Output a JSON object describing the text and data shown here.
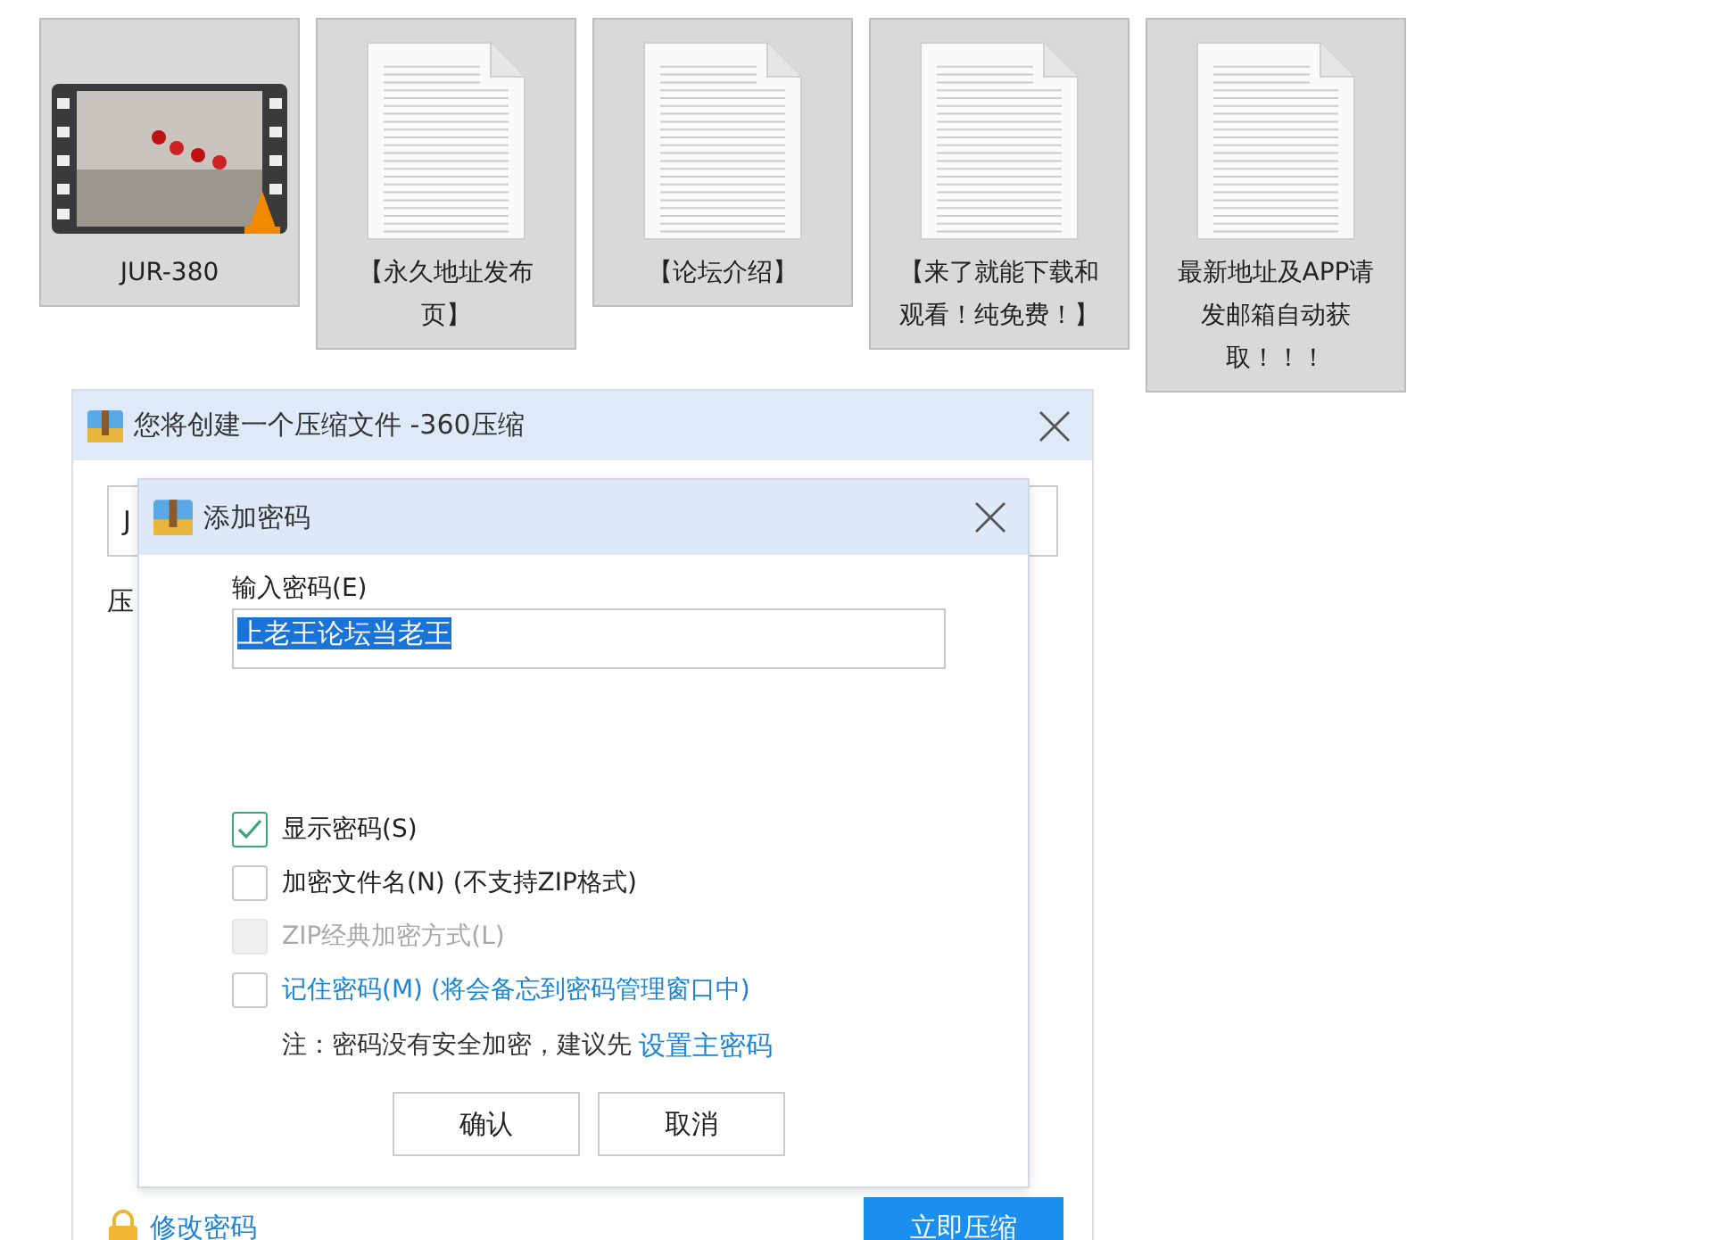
{
  "files": [
    {
      "kind": "video",
      "name": "JUR-380",
      "selected": true
    },
    {
      "kind": "document",
      "name": "【永久地址发布页】",
      "selected": true
    },
    {
      "kind": "document",
      "name": "【论坛介绍】",
      "selected": true
    },
    {
      "kind": "document",
      "name": "【来了就能下载和观看！纯免费！】",
      "selected": true
    },
    {
      "kind": "document",
      "name": "最新地址及APP请发邮箱自动获取！！！",
      "selected": true
    }
  ],
  "compress_dialog": {
    "title": "您将创建一个压缩文件 -360压缩",
    "archive_field": "J",
    "label": "压",
    "change_password_link": "修改密码",
    "compress_button": "立即压缩"
  },
  "password_dialog": {
    "title": "添加密码",
    "password_label": "输入密码(E)",
    "password_value": "上老王论坛当老王",
    "value_highlighted": true,
    "options": [
      {
        "kind": "plain",
        "label": "显示密码(S)",
        "checked": true,
        "disabled": false
      },
      {
        "kind": "plain",
        "label": "加密文件名(N) (不支持ZIP格式)",
        "checked": false,
        "disabled": false
      },
      {
        "kind": "plain",
        "label": "ZIP经典加密方式(L)",
        "checked": false,
        "disabled": true
      },
      {
        "kind": "link",
        "label": "记住密码(M) (将会备忘到密码管理窗口中)",
        "checked": false,
        "disabled": false
      }
    ],
    "note": "注：密码没有安全加密，建议先",
    "note_link": "设置主密码",
    "buttons": [
      "确认",
      "取消"
    ]
  }
}
